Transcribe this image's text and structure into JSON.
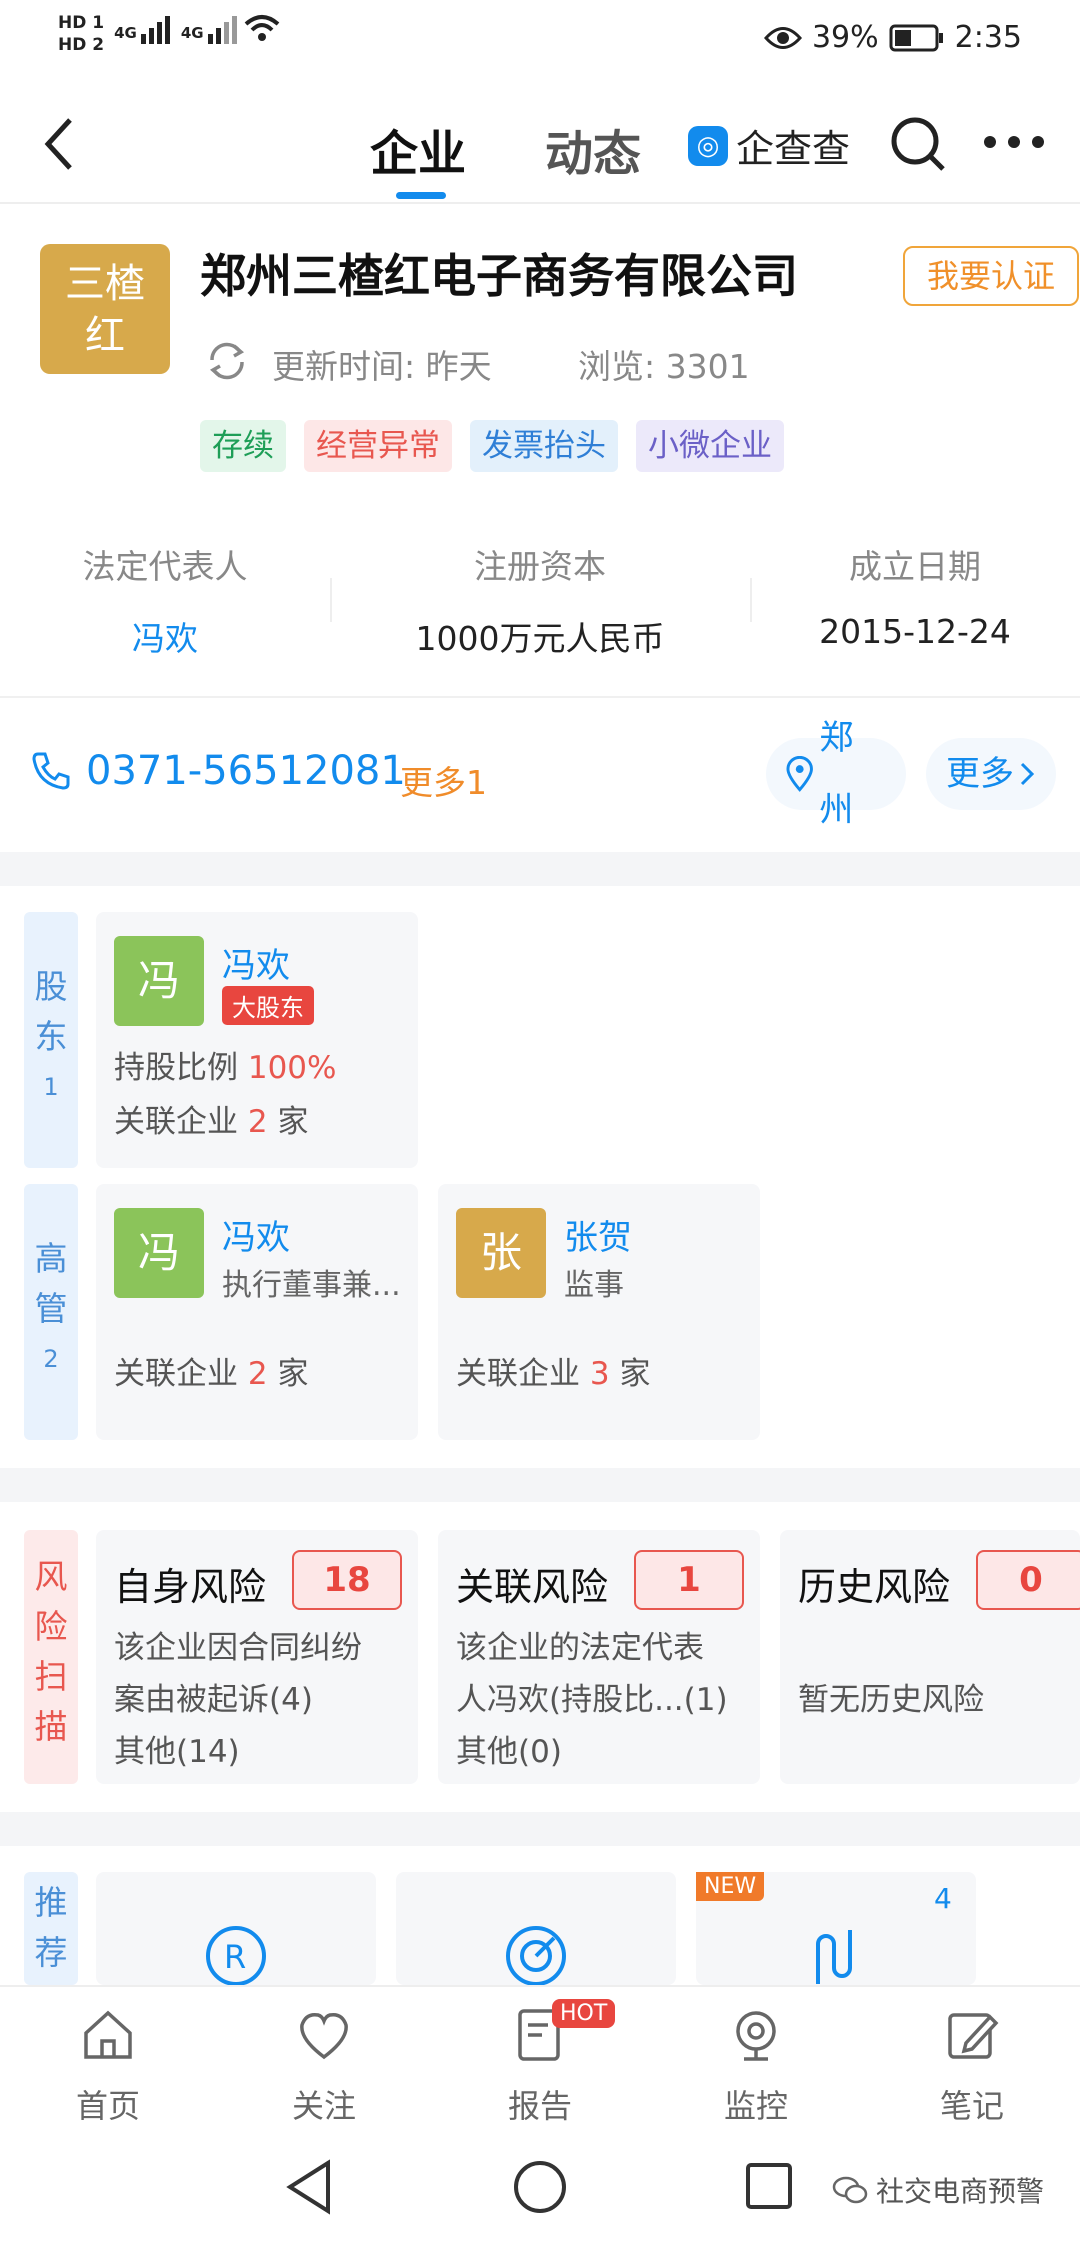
{
  "status_bar": {
    "hd1": "HD 1",
    "hd2": "HD 2",
    "net1": "4G",
    "net2": "4G",
    "battery": "39%",
    "time": "2:35"
  },
  "nav": {
    "tab_company": "企业",
    "tab_news": "动态",
    "brand": "企查查"
  },
  "company": {
    "logo_line1": "三楂",
    "logo_line2": "红",
    "name": "郑州三楂红电子商务有限公司",
    "claim": "我要认证",
    "updated": "更新时间: 昨天",
    "views": "浏览: 3301",
    "tags": [
      "存续",
      "经营异常",
      "发票抬头",
      "小微企业"
    ]
  },
  "info": {
    "legal_rep_label": "法定代表人",
    "legal_rep": "冯欢",
    "capital_label": "注册资本",
    "capital": "1000万元人民币",
    "founded_label": "成立日期",
    "founded": "2015-12-24"
  },
  "contact": {
    "phone": "0371-56512081",
    "more_phone": "更多1",
    "city": "郑州",
    "more": "更多"
  },
  "shareholders": {
    "label_1": "股",
    "label_2": "东",
    "count": "1",
    "items": [
      {
        "avatar": "冯",
        "name": "冯欢",
        "badge": "大股东",
        "ratio_label": "持股比例",
        "ratio": "100%",
        "related_label": "关联企业",
        "related_count": "2",
        "related_unit": "家"
      }
    ]
  },
  "executives": {
    "label_1": "高",
    "label_2": "管",
    "count": "2",
    "items": [
      {
        "avatar": "冯",
        "name": "冯欢",
        "title": "执行董事兼...",
        "related_label": "关联企业",
        "related_count": "2",
        "related_unit": "家"
      },
      {
        "avatar": "张",
        "name": "张贺",
        "title": "监事",
        "related_label": "关联企业",
        "related_count": "3",
        "related_unit": "家"
      }
    ]
  },
  "risk": {
    "label": [
      "风",
      "险",
      "扫",
      "描"
    ],
    "cards": [
      {
        "title": "自身风险",
        "count": "18",
        "desc1": "该企业因合同纠纷",
        "desc2": "案由被起诉(4)",
        "desc3": "其他(14)"
      },
      {
        "title": "关联风险",
        "count": "1",
        "desc1": "该企业的法定代表",
        "desc2": "人冯欢(持股比...(1)",
        "desc3": "其他(0)"
      },
      {
        "title": "历史风险",
        "count": "0",
        "desc1": "",
        "desc2": "暂无历史风险",
        "desc3": ""
      }
    ]
  },
  "recommend": {
    "label_1": "推",
    "label_2": "荐",
    "new_badge": "NEW",
    "count": "4"
  },
  "bottom_nav": {
    "home": "首页",
    "follow": "关注",
    "report": "报告",
    "hot": "HOT",
    "monitor": "监控",
    "notes": "笔记"
  },
  "watermark": "社交电商预警"
}
